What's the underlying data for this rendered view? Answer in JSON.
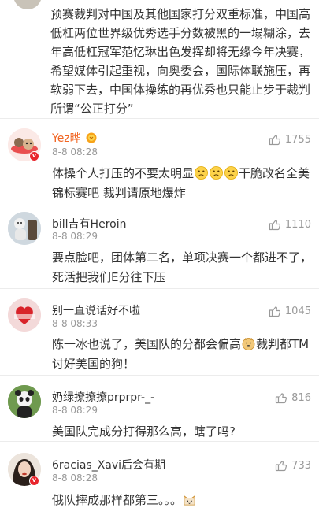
{
  "top_comment": {
    "text": "预赛裁判对中国及其他国家打分双重标准，中国高低杠两位世界级优秀选手分数被黑的一塌糊涂，去年高低杠冠军范忆琳出色发挥却将无缘今年决赛，希望媒体引起重视，向奥委会，国际体联施压，再软弱下去，中国体操练的再优秀也只能止步于裁判所谓“公正打分”"
  },
  "comments": [
    {
      "username": "Yez晔",
      "vip": true,
      "time": "8-8 08:28",
      "likes": "1755",
      "text_parts": [
        "体操个人打压的不要太明显",
        "",
        "",
        "",
        "干脆改名全美锦标赛吧 裁判请原地爆炸"
      ]
    },
    {
      "username": "bill吉有Heroin",
      "vip": false,
      "time": "8-8 08:29",
      "likes": "1110",
      "text": "要点脸吧，团体第二名，单项决赛一个都进不了，死活把我们E分往下压"
    },
    {
      "username": "别一直说话好不啦",
      "vip": false,
      "time": "8-8 08:33",
      "likes": "1045",
      "text_parts": [
        "陈一冰也说了，美国队的分都会偏高",
        "裁判都TM讨好美国的狗！"
      ]
    },
    {
      "username": "奶绿撩撩撩prprpr-_-",
      "vip": false,
      "time": "8-8 08:29",
      "likes": "816",
      "text": "美国队完成分打得那么高，瞎了吗?"
    },
    {
      "username": "6racias_Xavi后会有期",
      "vip": false,
      "time": "8-8 08:28",
      "likes": "733",
      "text_parts": [
        "俄队摔成那样都第三。。。",
        ""
      ]
    }
  ],
  "colors": {
    "vip_name": "#f26522",
    "meta_gray": "#999999",
    "badge_red": "#e8262d"
  }
}
